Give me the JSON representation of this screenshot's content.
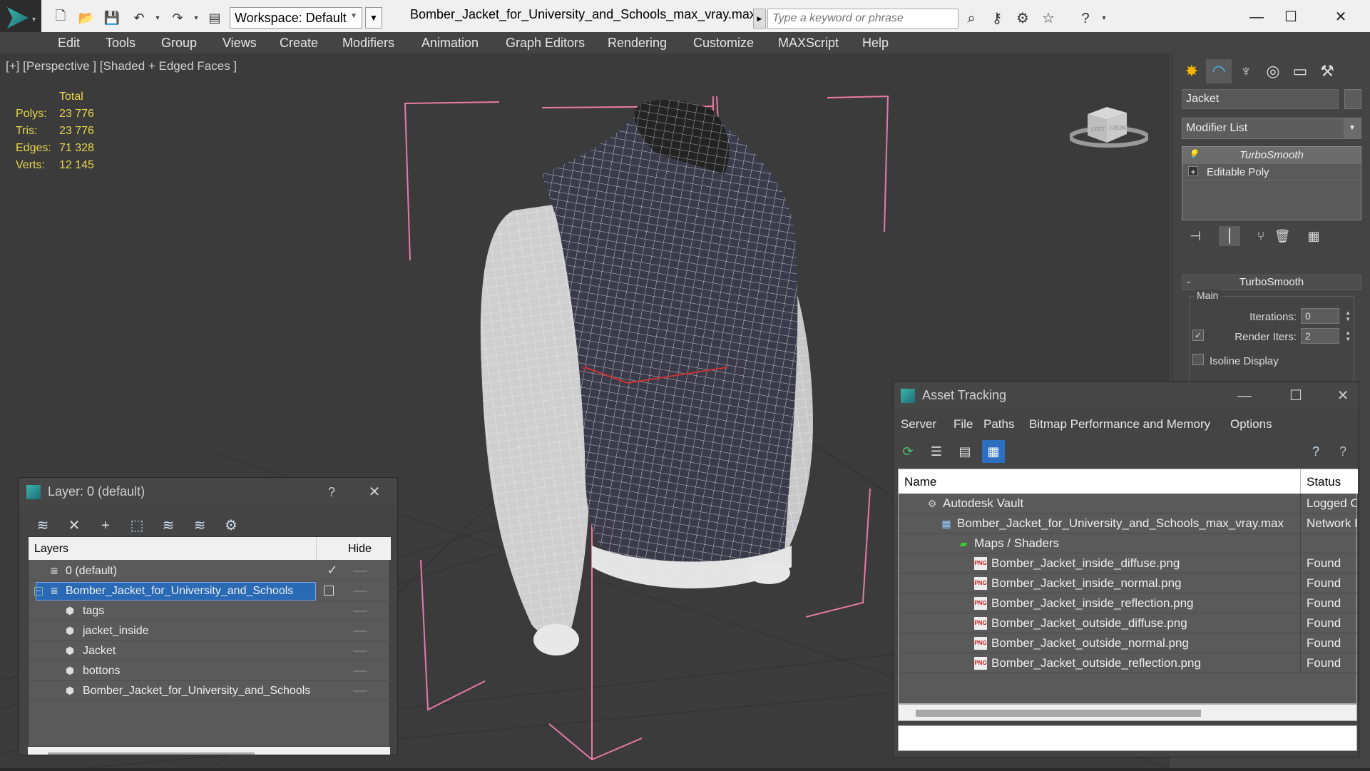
{
  "titlebar": {
    "workspace_label": "Workspace: Default",
    "document_title": "Bomber_Jacket_for_University_and_Schools_max_vray.max",
    "search_placeholder": "Type a keyword or phrase"
  },
  "menu": [
    "Edit",
    "Tools",
    "Group",
    "Views",
    "Create",
    "Modifiers",
    "Animation",
    "Graph Editors",
    "Rendering",
    "Customize",
    "MAXScript",
    "Help"
  ],
  "viewport": {
    "label": "[+] [Perspective ] [Shaded + Edged Faces ]",
    "stats_header": "Total",
    "stats": [
      {
        "key": "Polys:",
        "value": "23 776"
      },
      {
        "key": "Tris:",
        "value": "23 776"
      },
      {
        "key": "Edges:",
        "value": "71 328"
      },
      {
        "key": "Verts:",
        "value": "12 145"
      }
    ],
    "viewcube_left": "LEFT",
    "viewcube_front": "FRONT"
  },
  "command_panel": {
    "object_name": "Jacket",
    "modifier_list": "Modifier List",
    "stack": [
      "TurboSmooth",
      "Editable Poly"
    ],
    "rollout_title": "TurboSmooth",
    "group_main": "Main",
    "iterations_label": "Iterations:",
    "iterations_value": "0",
    "render_iters_label": "Render Iters:",
    "render_iters_value": "2",
    "isoline_label": "Isoline Display"
  },
  "layer_dialog": {
    "title": "Layer: 0 (default)",
    "help": "?",
    "col_layers": "Layers",
    "col_hide": "Hide",
    "rows": [
      {
        "name": "0 (default)"
      },
      {
        "name": "Bomber_Jacket_for_University_and_Schools"
      },
      {
        "name": "tags"
      },
      {
        "name": "jacket_inside"
      },
      {
        "name": "Jacket"
      },
      {
        "name": "bottons"
      },
      {
        "name": "Bomber_Jacket_for_University_and_Schools"
      }
    ],
    "check_mark": "✓"
  },
  "asset_tracking": {
    "title": "Asset Tracking",
    "menu": [
      "Server",
      "File",
      "Paths",
      "Bitmap Performance and Memory",
      "Options"
    ],
    "col_name": "Name",
    "col_status": "Status",
    "rows": [
      {
        "name": "Autodesk Vault",
        "status": "Logged Out"
      },
      {
        "name": "Bomber_Jacket_for_University_and_Schools_max_vray.max",
        "status": "Network Path"
      },
      {
        "name": "Maps / Shaders",
        "status": ""
      },
      {
        "name": "Bomber_Jacket_inside_diffuse.png",
        "status": "Found"
      },
      {
        "name": "Bomber_Jacket_inside_normal.png",
        "status": "Found"
      },
      {
        "name": "Bomber_Jacket_inside_reflection.png",
        "status": "Found"
      },
      {
        "name": "Bomber_Jacket_outside_diffuse.png",
        "status": "Found"
      },
      {
        "name": "Bomber_Jacket_outside_normal.png",
        "status": "Found"
      },
      {
        "name": "Bomber_Jacket_outside_reflection.png",
        "status": "Found"
      }
    ],
    "png_badge": "PNG"
  },
  "colors": {
    "accent": "#2a6ab5",
    "stats_yellow": "#e8d64a",
    "bbox_pink": "#e87aa8",
    "viewport_bg": "#3b3b3b"
  }
}
